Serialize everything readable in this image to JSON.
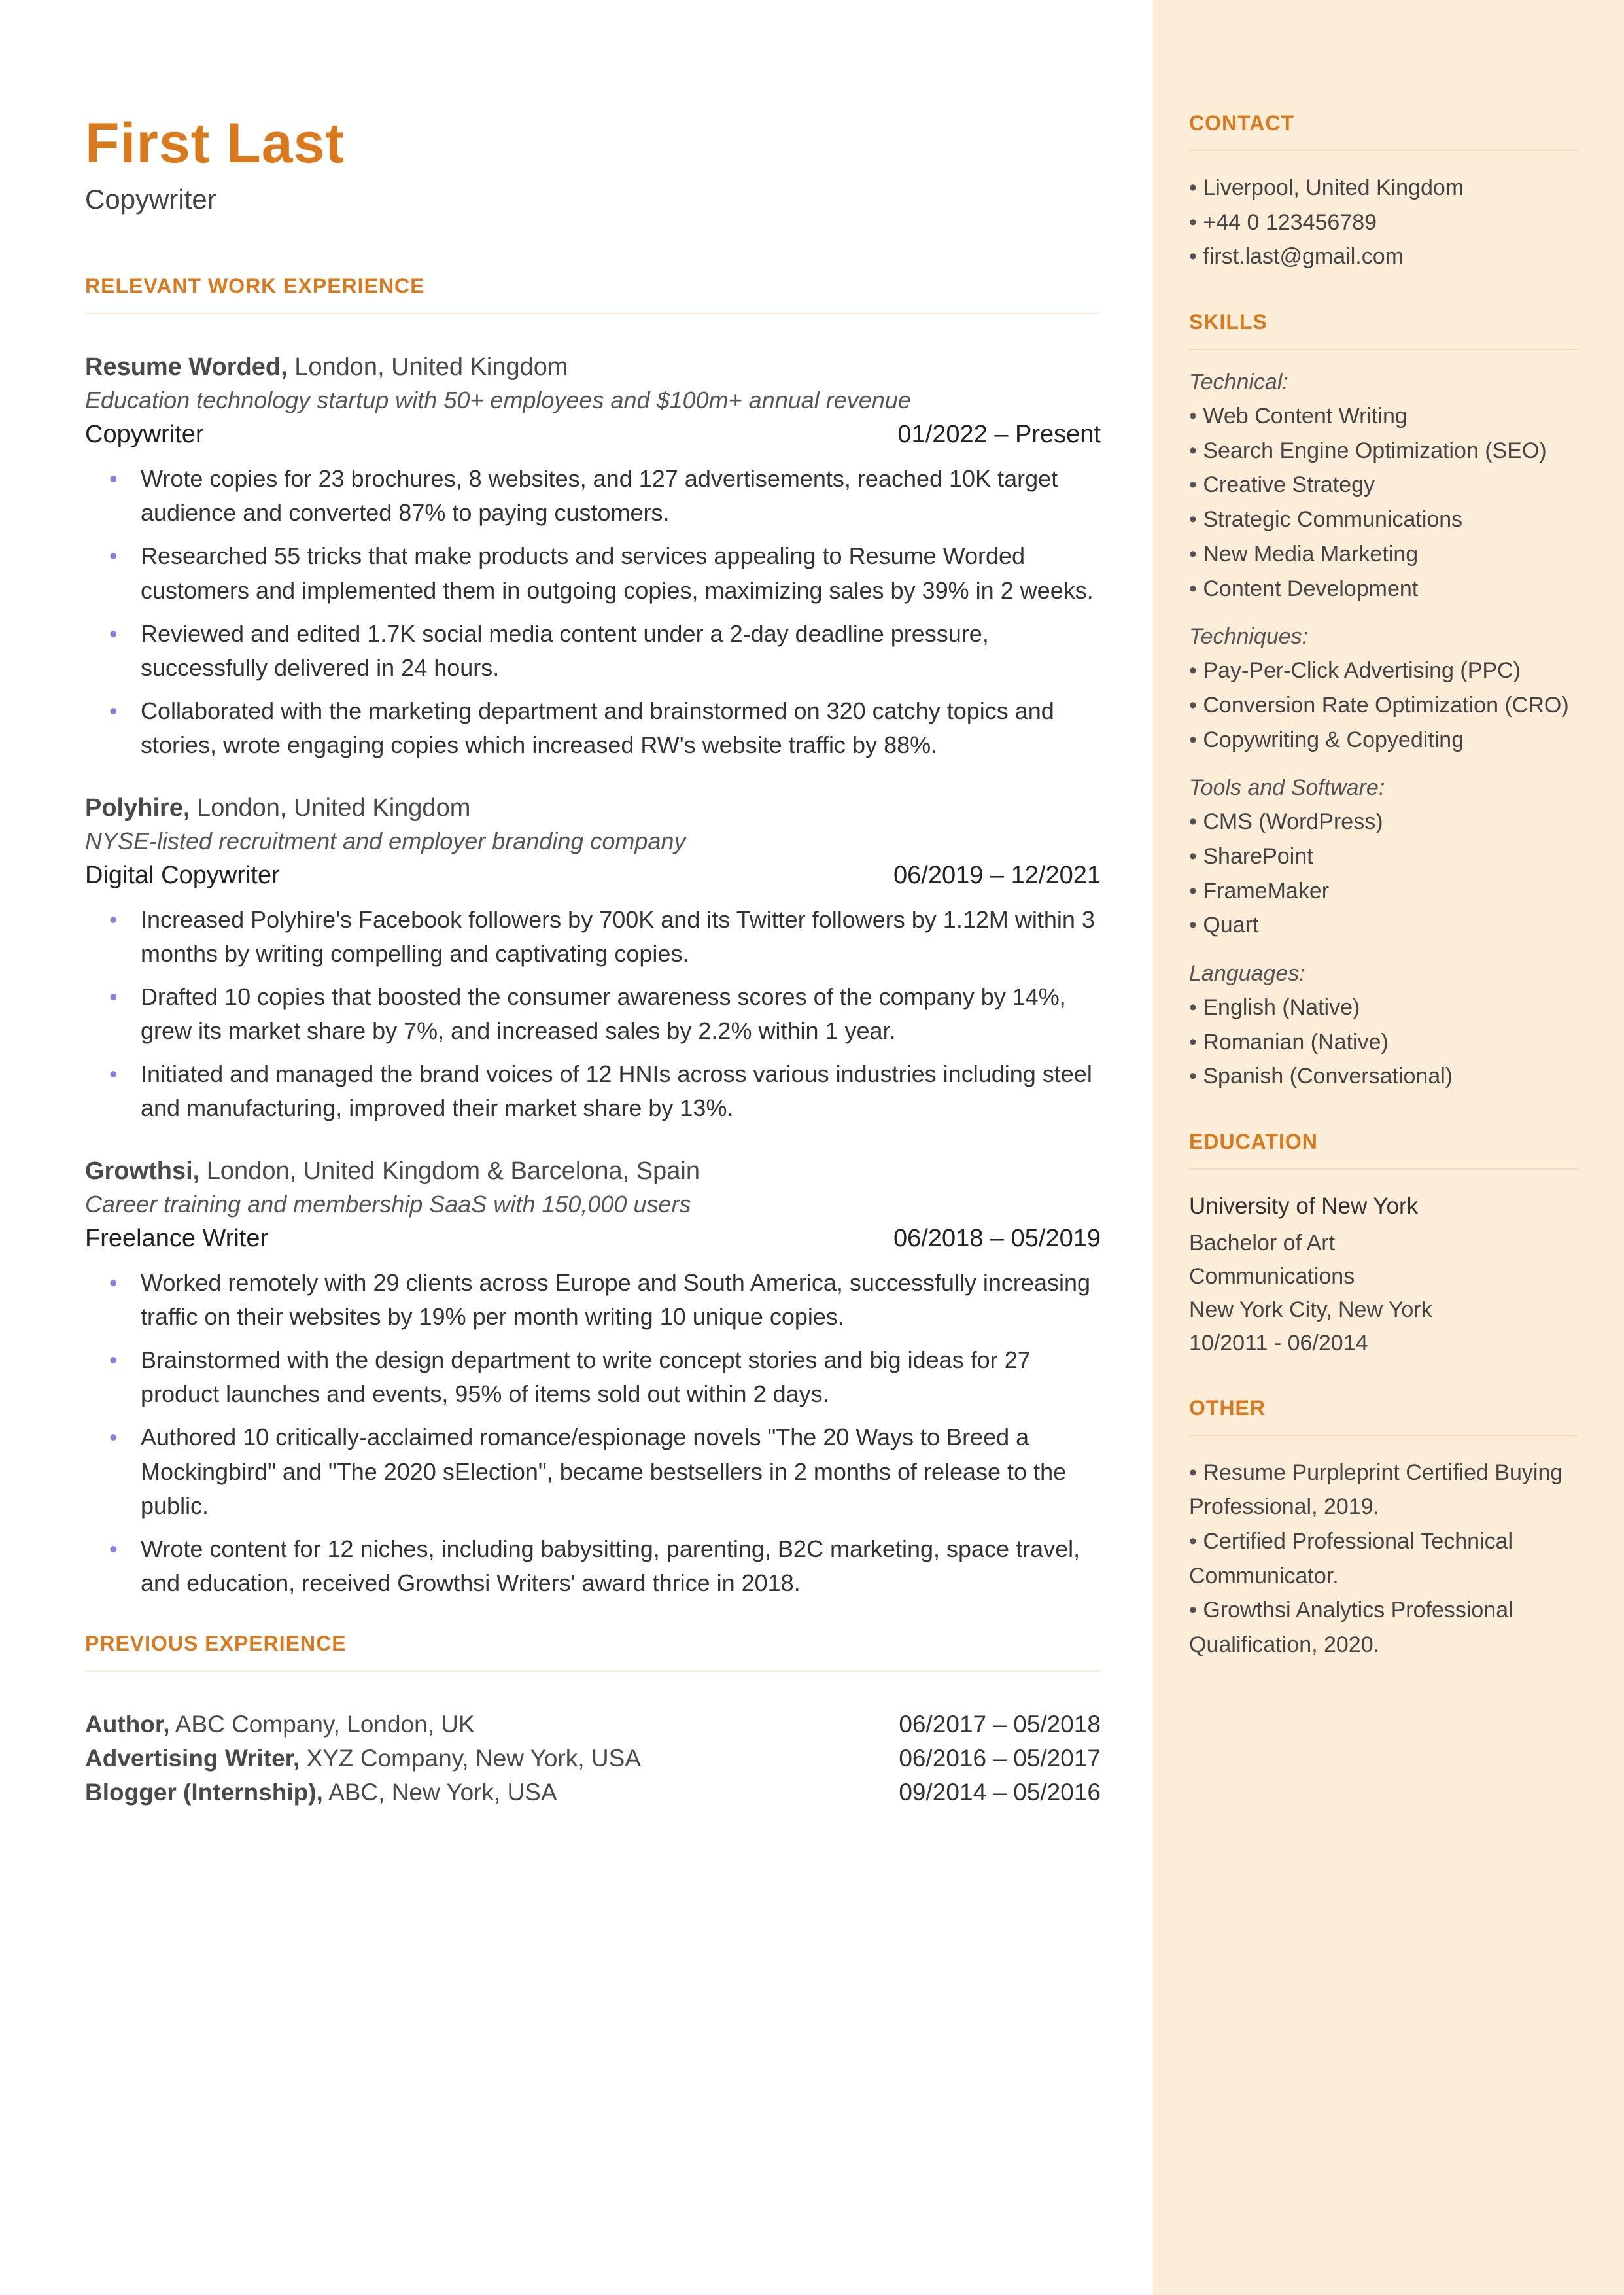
{
  "name": "First Last",
  "title": "Copywriter",
  "sections": {
    "work": "RELEVANT WORK EXPERIENCE",
    "prev": "PREVIOUS EXPERIENCE",
    "contact": "CONTACT",
    "skills": "SKILLS",
    "education": "EDUCATION",
    "other": "OTHER"
  },
  "jobs": [
    {
      "company": "Resume Worded,",
      "location": " London, United Kingdom",
      "desc": "Education technology startup with 50+ employees and $100m+ annual revenue",
      "role": "Copywriter",
      "dates": "01/2022 – Present",
      "bullets": [
        "Wrote copies for 23 brochures, 8 websites, and 127 advertisements, reached 10K target audience and converted 87% to paying customers.",
        "Researched 55 tricks that make products and services appealing to Resume Worded customers and implemented them in outgoing copies, maximizing sales by 39% in 2 weeks.",
        "Reviewed and edited 1.7K social media content under a 2-day deadline pressure, successfully delivered in 24 hours.",
        "Collaborated with the marketing department and brainstormed on 320 catchy topics and stories, wrote engaging copies which increased RW's website traffic by 88%."
      ]
    },
    {
      "company": "Polyhire,",
      "location": " London, United Kingdom",
      "desc": "NYSE-listed recruitment and employer branding company",
      "role": "Digital Copywriter",
      "dates": "06/2019 – 12/2021",
      "bullets": [
        "Increased Polyhire's Facebook followers by 700K and its Twitter followers by 1.12M within 3 months by writing compelling and captivating copies.",
        "Drafted 10 copies that boosted the consumer awareness scores of the company by 14%, grew its market share by 7%, and increased sales by 2.2% within 1 year.",
        "Initiated and managed the brand voices of 12 HNIs across various industries including steel and manufacturing, improved their market share by 13%."
      ]
    },
    {
      "company": "Growthsi,",
      "location": " London, United Kingdom & Barcelona, Spain",
      "desc": "Career training and membership SaaS with 150,000 users",
      "role": "Freelance Writer",
      "dates": "06/2018 – 05/2019",
      "bullets": [
        "Worked remotely with 29 clients across Europe and South America, successfully increasing traffic on their websites by 19% per month writing 10 unique copies.",
        "Brainstormed with the design department to write concept stories and big ideas for 27 product launches and events, 95% of items sold out within 2 days.",
        "Authored 10 critically-acclaimed romance/espionage novels \"The 20 Ways to Breed a Mockingbird\" and \"The 2020 sElection\", became bestsellers in 2 months of release to the public.",
        "Wrote content for 12 niches, including babysitting, parenting, B2C marketing, space travel, and education, received Growthsi Writers' award thrice in 2018."
      ]
    }
  ],
  "previous": [
    {
      "role": "Author,",
      "rest": " ABC Company, London, UK",
      "dates": "06/2017 – 05/2018"
    },
    {
      "role": "Advertising Writer,",
      "rest": " XYZ Company, New York, USA",
      "dates": "06/2016 – 05/2017"
    },
    {
      "role": "Blogger (Internship),",
      "rest": " ABC, New York, USA",
      "dates": "09/2014 – 05/2016"
    }
  ],
  "contact": [
    "Liverpool, United Kingdom",
    "+44 0 123456789",
    "first.last@gmail.com"
  ],
  "skills": {
    "technical_label": "Technical:",
    "technical": [
      "Web Content Writing",
      "Search Engine Optimization (SEO)",
      "Creative Strategy",
      "Strategic Communications",
      "New Media Marketing",
      "Content Development"
    ],
    "techniques_label": "Techniques:",
    "techniques": [
      "Pay-Per-Click Advertising (PPC)",
      "Conversion Rate Optimization (CRO)",
      "Copywriting & Copyediting"
    ],
    "tools_label": "Tools and Software:",
    "tools": [
      "CMS (WordPress)",
      "SharePoint",
      "FrameMaker",
      "Quart"
    ],
    "languages_label": "Languages:",
    "languages": [
      "English (Native)",
      "Romanian (Native)",
      "Spanish (Conversational)"
    ]
  },
  "education": {
    "school": "University of New York",
    "degree": "Bachelor of Art",
    "major": "Communications",
    "loc": "New York City, New York",
    "dates": "10/2011 - 06/2014"
  },
  "other": [
    "Resume Purpleprint Certified Buying Professional, 2019.",
    "Certified Professional Technical Communicator.",
    "Growthsi Analytics Professional Qualification, 2020."
  ]
}
